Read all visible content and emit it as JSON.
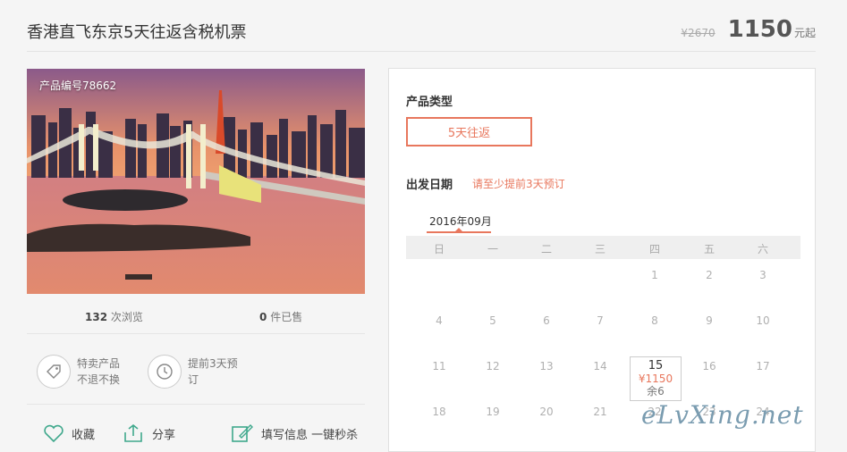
{
  "header": {
    "title": "香港直飞东京5天往返含税机票",
    "old_price": "¥2670",
    "price": "1150",
    "unit": "元起"
  },
  "photo": {
    "product_no": "产品编号78662"
  },
  "stats": {
    "views_num": "132",
    "views_label": "次浏览",
    "sold_num": "0",
    "sold_label": "件已售"
  },
  "promos": [
    {
      "icon": "tag-icon",
      "line1": "特卖产品",
      "line2": "不退不换"
    },
    {
      "icon": "clock-icon",
      "line1": "提前3天预",
      "line2": "订"
    }
  ],
  "actions": {
    "favorite": "收藏",
    "share": "分享",
    "fill": "填写信息 一键秒杀"
  },
  "panel": {
    "type_label": "产品类型",
    "type_option": "5天往返",
    "date_label": "出发日期",
    "date_hint": "请至少提前3天预订",
    "month": "2016年09月",
    "weekdays": [
      "日",
      "一",
      "二",
      "三",
      "四",
      "五",
      "六"
    ],
    "rows": [
      [
        "",
        "",
        "",
        "",
        "1",
        "2",
        "3"
      ],
      [
        "4",
        "5",
        "6",
        "7",
        "8",
        "9",
        "10"
      ],
      [
        "11",
        "12",
        "13",
        "14",
        "",
        "16",
        "17"
      ],
      [
        "18",
        "19",
        "20",
        "21",
        "22",
        "23",
        "24"
      ]
    ],
    "selected": {
      "day": "15",
      "price": "¥1150",
      "remain": "余6"
    }
  },
  "watermark": "eLvXing.net",
  "colors": {
    "accent": "#e8775d"
  }
}
